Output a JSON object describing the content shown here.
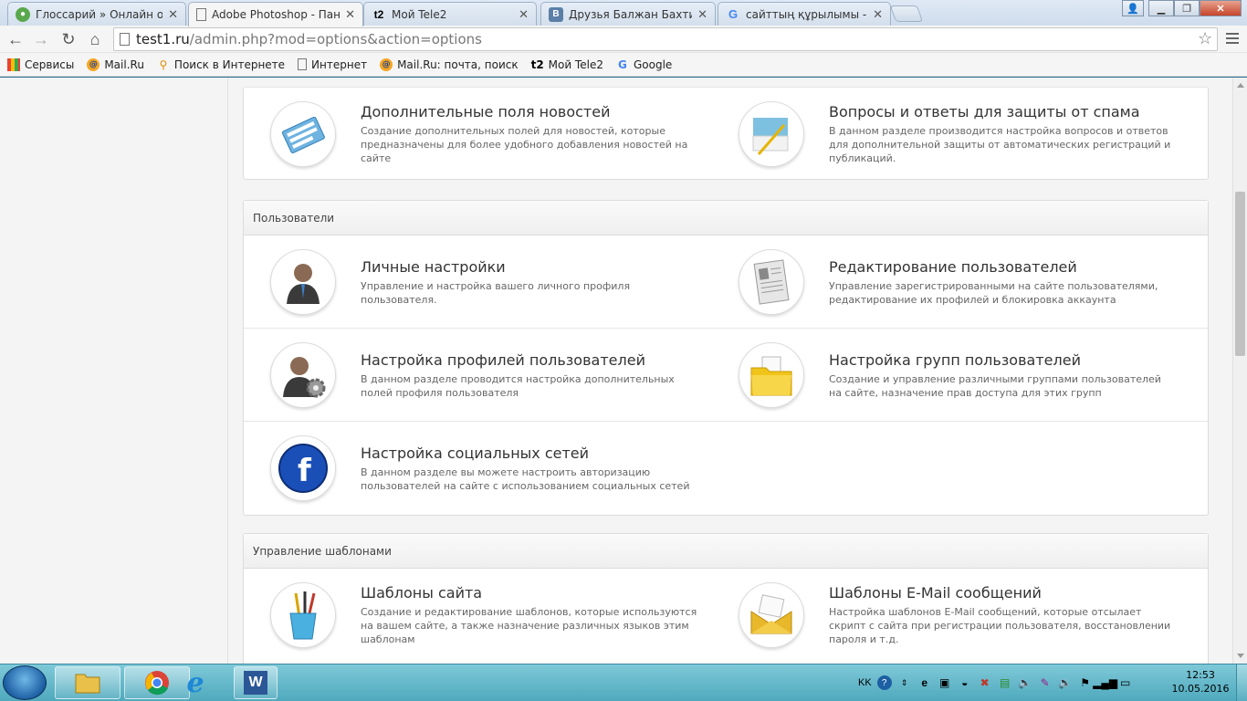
{
  "browser": {
    "tabs": [
      {
        "title": "Глоссарий » Онлайн оку",
        "favicon": "glossary-icon"
      },
      {
        "title": "Adobe Photoshop - Пане",
        "favicon": "page-icon",
        "active": true
      },
      {
        "title": "Мой Tele2",
        "favicon": "tele2-icon"
      },
      {
        "title": "Друзья Балжан Бахтияро",
        "favicon": "vk-icon"
      },
      {
        "title": "сайттың құрылымы - По",
        "favicon": "google-icon"
      }
    ],
    "url_host": "test1.ru",
    "url_rest": "/admin.php?mod=options&action=options",
    "bookmarks": [
      {
        "label": "Сервисы",
        "icon": "apps-grid-icon"
      },
      {
        "label": "Mail.Ru",
        "icon": "mailru-icon"
      },
      {
        "label": "Поиск в Интернете",
        "icon": "search-magnifier-icon"
      },
      {
        "label": "Интернет",
        "icon": "page-icon"
      },
      {
        "label": "Mail.Ru: почта, поиск",
        "icon": "mailru-icon"
      },
      {
        "label": "Мой Tele2",
        "icon": "tele2-icon"
      },
      {
        "label": "Google",
        "icon": "google-icon"
      }
    ]
  },
  "sections": [
    {
      "header": "",
      "rows": [
        [
          {
            "title": "Дополнительные поля новостей",
            "desc": "Создание дополнительных полей для новостей, которые предназначены для более удобного добавления новостей на сайте",
            "icon": "news-fields-icon"
          },
          {
            "title": "Вопросы и ответы для защиты от спама",
            "desc": "В данном разделе производится настройка вопросов и ответов для дополнительной защиты от автоматических регистраций и публикаций.",
            "icon": "spam-questions-icon"
          }
        ]
      ]
    },
    {
      "header": "Пользователи",
      "rows": [
        [
          {
            "title": "Личные настройки",
            "desc": "Управление и настройка вашего личного профиля пользователя.",
            "icon": "user-avatar-icon"
          },
          {
            "title": "Редактирование пользователей",
            "desc": "Управление зарегистрированными на сайте пользователями, редактирование их профилей и блокировка аккаунта",
            "icon": "user-document-icon"
          }
        ],
        [
          {
            "title": "Настройка профилей пользователей",
            "desc": "В данном разделе проводится настройка дополнительных полей профиля пользователя",
            "icon": "user-gear-icon"
          },
          {
            "title": "Настройка групп пользователей",
            "desc": "Создание и управление различными группами пользователей на сайте, назначение прав доступа для этих групп",
            "icon": "folder-icon"
          }
        ],
        [
          {
            "title": "Настройка социальных сетей",
            "desc": "В данном разделе вы можете настроить авторизацию пользователей на сайте с использованием социальных сетей",
            "icon": "facebook-icon"
          }
        ]
      ]
    },
    {
      "header": "Управление шаблонами",
      "rows": [
        [
          {
            "title": "Шаблоны сайта",
            "desc": "Создание и редактирование шаблонов, которые используются на вашем сайте, а также назначение различных языков этим шаблонам",
            "icon": "brushes-cup-icon"
          },
          {
            "title": "Шаблоны E-Mail сообщений",
            "desc": "Настройка шаблонов E-Mail сообщений, которые отсылает скрипт с сайта при регистрации пользователя, восстановлении пароля и т.д.",
            "icon": "envelope-icon"
          }
        ]
      ]
    }
  ],
  "taskbar": {
    "language": "KK",
    "time": "12:53",
    "date": "10.05.2016"
  }
}
